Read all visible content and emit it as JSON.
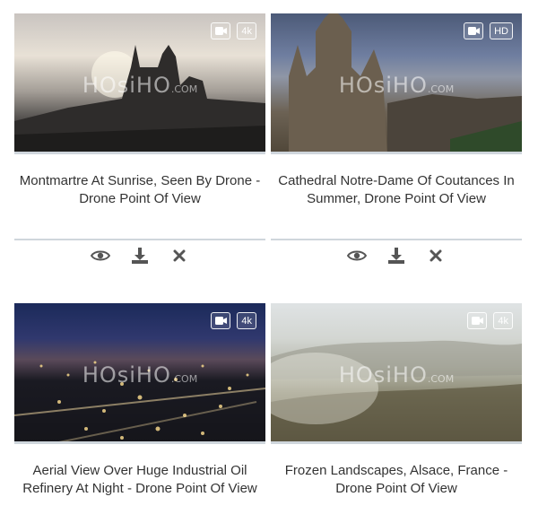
{
  "videos": [
    {
      "title": "Montmartre At Sunrise, Seen By Drone - Drone Point Of View",
      "quality": "4k",
      "watermark": "HOsiHO",
      "watermark_suffix": ".COM",
      "icons": [
        "camera-icon"
      ],
      "actions": [
        "eye-icon",
        "download-icon",
        "close-icon"
      ]
    },
    {
      "title": "Cathedral Notre-Dame Of Coutances In Summer, Drone Point Of View",
      "quality": "HD",
      "watermark": "HOsiHO",
      "watermark_suffix": ".COM",
      "icons": [
        "camera-icon"
      ],
      "actions": [
        "eye-icon",
        "download-icon",
        "close-icon"
      ]
    },
    {
      "title": "Aerial View Over Huge Industrial Oil Refinery At Night - Drone Point Of View",
      "quality": "4k",
      "watermark": "HOsiHO",
      "watermark_suffix": ".COM",
      "icons": [
        "camera-icon"
      ]
    },
    {
      "title": "Frozen Landscapes, Alsace, France - Drone Point Of View",
      "quality": "4k",
      "watermark": "HOsiHO",
      "watermark_suffix": ".COM",
      "icons": [
        "camera-icon"
      ]
    }
  ],
  "colors": {
    "divider": "#cfd6dc",
    "action_icon": "#555555",
    "text": "#333333"
  }
}
